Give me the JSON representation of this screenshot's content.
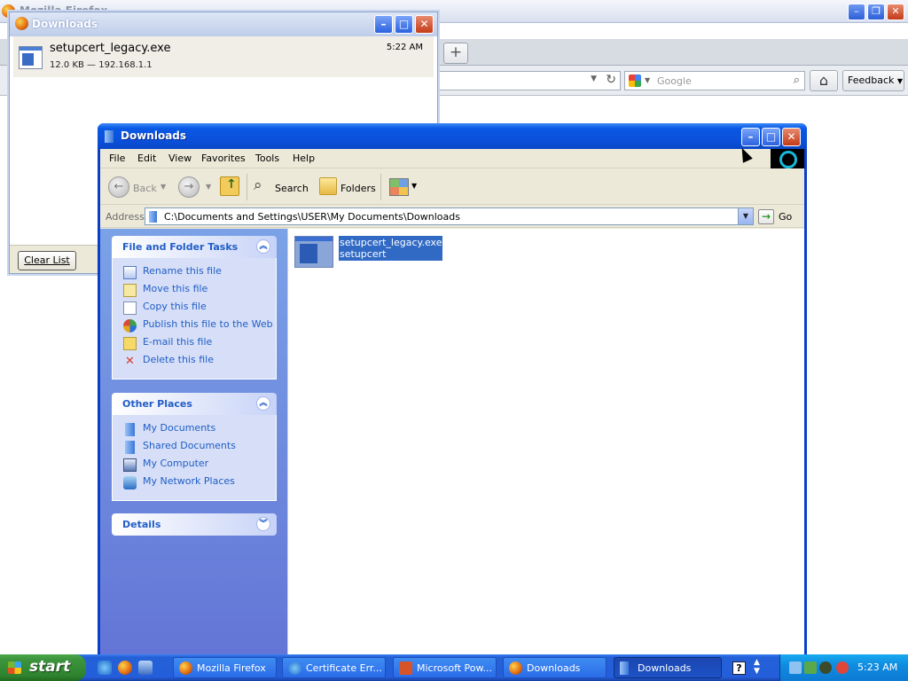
{
  "firefox": {
    "title": "Mozilla Firefox",
    "new_tab": "+",
    "search_placeholder": "Google",
    "feedback": "Feedback",
    "controls": {
      "minimize": "–",
      "restore": "❐",
      "close": "✕"
    }
  },
  "downloads_window": {
    "title": "Downloads",
    "item": {
      "name": "setupcert_legacy.exe",
      "meta": "12.0 KB — 192.168.1.1",
      "time": "5:22 AM"
    },
    "clear_list": "Clear List"
  },
  "explorer": {
    "title": "Downloads",
    "menu": [
      "File",
      "Edit",
      "View",
      "Favorites",
      "Tools",
      "Help"
    ],
    "toolbar": {
      "back": "Back",
      "search": "Search",
      "folders": "Folders"
    },
    "address": {
      "label": "Address",
      "path": "C:\\Documents and Settings\\USER\\My Documents\\Downloads",
      "go": "Go"
    },
    "file_folder_tasks": {
      "title": "File and Folder Tasks",
      "items": [
        {
          "label": "Rename this file",
          "icon": "rename-icon"
        },
        {
          "label": "Move this file",
          "icon": "move-icon"
        },
        {
          "label": "Copy this file",
          "icon": "copy-icon"
        },
        {
          "label": "Publish this file to the Web",
          "icon": "publish-web-icon"
        },
        {
          "label": "E-mail this file",
          "icon": "email-icon"
        },
        {
          "label": "Delete this file",
          "icon": "delete-icon"
        }
      ]
    },
    "other_places": {
      "title": "Other Places",
      "items": [
        {
          "label": "My Documents",
          "icon": "my-documents-icon"
        },
        {
          "label": "Shared Documents",
          "icon": "shared-documents-icon"
        },
        {
          "label": "My Computer",
          "icon": "my-computer-icon"
        },
        {
          "label": "My Network Places",
          "icon": "network-places-icon"
        }
      ]
    },
    "details": {
      "title": "Details"
    },
    "file": {
      "name": "setupcert_legacy.exe",
      "description": "setupcert"
    }
  },
  "taskbar": {
    "start": "start",
    "tasks": [
      {
        "label": "Mozilla Firefox",
        "active": false
      },
      {
        "label": "Certificate Err...",
        "active": false
      },
      {
        "label": "Microsoft Pow...",
        "active": false
      },
      {
        "label": "Downloads",
        "active": false
      },
      {
        "label": "Downloads",
        "active": true
      }
    ],
    "help": "?",
    "clock": "5:23 AM"
  }
}
